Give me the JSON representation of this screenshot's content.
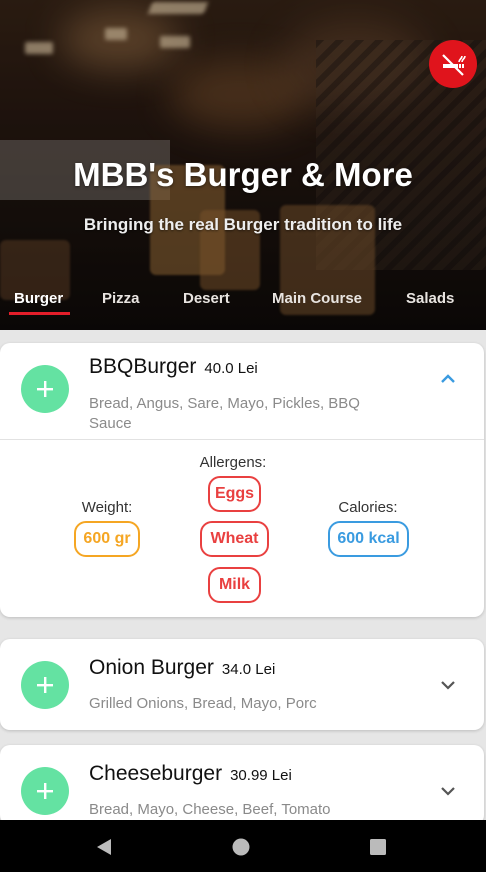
{
  "hero": {
    "title": "MBB's Burger & More",
    "subtitle": "Bringing the real Burger tradition to life",
    "no_smoking_icon": "no-smoking-icon"
  },
  "tabs": [
    {
      "label": "Burger",
      "active": true
    },
    {
      "label": "Pizza",
      "active": false
    },
    {
      "label": "Desert",
      "active": false
    },
    {
      "label": "Main Course",
      "active": false
    },
    {
      "label": "Salads",
      "active": false
    }
  ],
  "menu_items": [
    {
      "name": "BBQBurger",
      "price": "40.0 Lei",
      "description": "Bread, Angus, Sare, Mayo, Pickles, BBQ Sauce",
      "expanded": true,
      "details": {
        "weight_label": "Weight:",
        "weight_value": "600 gr",
        "allergens_label": "Allergens:",
        "allergens": [
          "Eggs",
          "Wheat",
          "Milk"
        ],
        "calories_label": "Calories:",
        "calories_value": "600 kcal"
      }
    },
    {
      "name": "Onion Burger",
      "price": "34.0 Lei",
      "description": "Grilled Onions, Bread, Mayo, Porc",
      "expanded": false
    },
    {
      "name": "Cheeseburger",
      "price": "30.99 Lei",
      "description": "Bread, Mayo, Cheese, Beef, Tomato",
      "expanded": false
    }
  ],
  "colors": {
    "accent_red": "#e41e2a",
    "add_green": "#64e2a2",
    "weight_orange": "#f5a623",
    "allergen_red": "#e94040",
    "calories_blue": "#3a9be0",
    "chevron_blue": "#3a9be0"
  },
  "navbar": {
    "icons": [
      "back-icon",
      "home-icon",
      "recents-icon"
    ]
  }
}
